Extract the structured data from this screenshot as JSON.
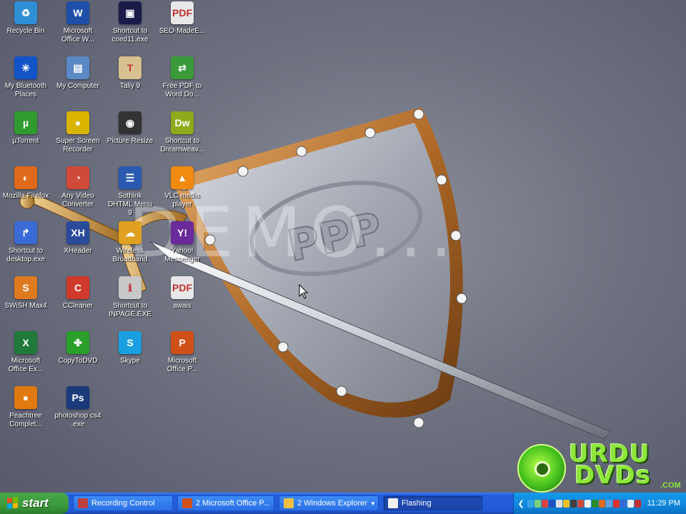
{
  "desktop": {
    "watermark": "DEMO...",
    "icons": [
      {
        "label": "Recycle Bin",
        "glyph": "♻",
        "color": "#2f8fd6"
      },
      {
        "label": "Microsoft Office W...",
        "glyph": "W",
        "color": "#1f4fa8"
      },
      {
        "label": "Shortcut to coed11.exe",
        "glyph": "▣",
        "color": "#1b1b4a"
      },
      {
        "label": "SEO-MadeE...",
        "glyph": "PDF",
        "color": "#e8e8e8"
      },
      {
        "label": "My Bluetooth Places",
        "glyph": "✳",
        "color": "#1254c8"
      },
      {
        "label": "My Computer",
        "glyph": "▤",
        "color": "#5a8ac6"
      },
      {
        "label": "Tally 9",
        "glyph": "T",
        "color": "#d8c090"
      },
      {
        "label": "Free PDF to Word Do...",
        "glyph": "⇄",
        "color": "#3a9a3a"
      },
      {
        "label": "µTorrent",
        "glyph": "µ",
        "color": "#2f9b2f"
      },
      {
        "label": "Super Screen Recorder",
        "glyph": "●",
        "color": "#d8b400"
      },
      {
        "label": "Picture Resize",
        "glyph": "◉",
        "color": "#333333"
      },
      {
        "label": "Shortcut to Dreamweav...",
        "glyph": "Dw",
        "color": "#8faa1a"
      },
      {
        "label": "Mozilla Firefox",
        "glyph": "◐",
        "color": "#e06a1c"
      },
      {
        "label": "Any Video Converter",
        "glyph": "◔",
        "color": "#d04a3a"
      },
      {
        "label": "Sothink DHTML Menu 9",
        "glyph": "☰",
        "color": "#2a5ab0"
      },
      {
        "label": "VLC media player",
        "glyph": "▲",
        "color": "#f08a10"
      },
      {
        "label": "Shortcut to desktop.exe",
        "glyph": "↱",
        "color": "#3a6ad6"
      },
      {
        "label": "XHeader",
        "glyph": "XH",
        "color": "#2a4a9a"
      },
      {
        "label": "Wireless Broadband",
        "glyph": "☁",
        "color": "#e0a020"
      },
      {
        "label": "Yahoo! Messenger",
        "glyph": "Y!",
        "color": "#6a2a9a"
      },
      {
        "label": "SWiSH Max4",
        "glyph": "S",
        "color": "#e07a20"
      },
      {
        "label": "CCleaner",
        "glyph": "C",
        "color": "#d03a2a"
      },
      {
        "label": "Shortcut to INPAGE.EXE",
        "glyph": "ℹ",
        "color": "#c8c8c8"
      },
      {
        "label": "awais",
        "glyph": "PDF",
        "color": "#e8e8e8"
      },
      {
        "label": "Microsoft Office Ex...",
        "glyph": "X",
        "color": "#1f7a3a"
      },
      {
        "label": "CopyToDVD",
        "glyph": "✤",
        "color": "#2aa02a"
      },
      {
        "label": "Skype",
        "glyph": "S",
        "color": "#1aa0e0"
      },
      {
        "label": "Microsoft Office P...",
        "glyph": "P",
        "color": "#d0501a"
      },
      {
        "label": "Peachtree Complet...",
        "glyph": "●",
        "color": "#e07a10"
      },
      {
        "label": "photoshop cs4 .exe",
        "glyph": "Ps",
        "color": "#1a3a7a"
      }
    ],
    "logo": {
      "line1": "URDU",
      "line2": "DVDs",
      "suffix": ".COM"
    }
  },
  "taskbar": {
    "start_label": "start",
    "tasks": [
      {
        "label": "Recording Control",
        "icon_color": "#c04040",
        "active": false,
        "has_arrow": false
      },
      {
        "label": "2 Microsoft Office P...",
        "icon_color": "#d0501a",
        "active": false,
        "has_arrow": true
      },
      {
        "label": "2 Windows Explorer",
        "icon_color": "#f0c040",
        "active": false,
        "has_arrow": true
      },
      {
        "label": "Flashing",
        "icon_color": "#f0f0f0",
        "active": true,
        "has_arrow": false
      }
    ],
    "tray": {
      "collapse_label": "❮",
      "icon_colors": [
        "#3aa0e0",
        "#7ad07a",
        "#e04040",
        "#2050c0",
        "#e0e0e0",
        "#f0c020",
        "#404040",
        "#d04a3a",
        "#f0f0f0",
        "#2a8a2a",
        "#e06a1c",
        "#60a0e0",
        "#e03030",
        "#3a6ad6",
        "#f0f0f0",
        "#c03030"
      ],
      "clock": "11:29 PM"
    },
    "colors": {
      "bar": "#245edc",
      "start": "#3c9a3c",
      "tray": "#0f86dc"
    }
  }
}
